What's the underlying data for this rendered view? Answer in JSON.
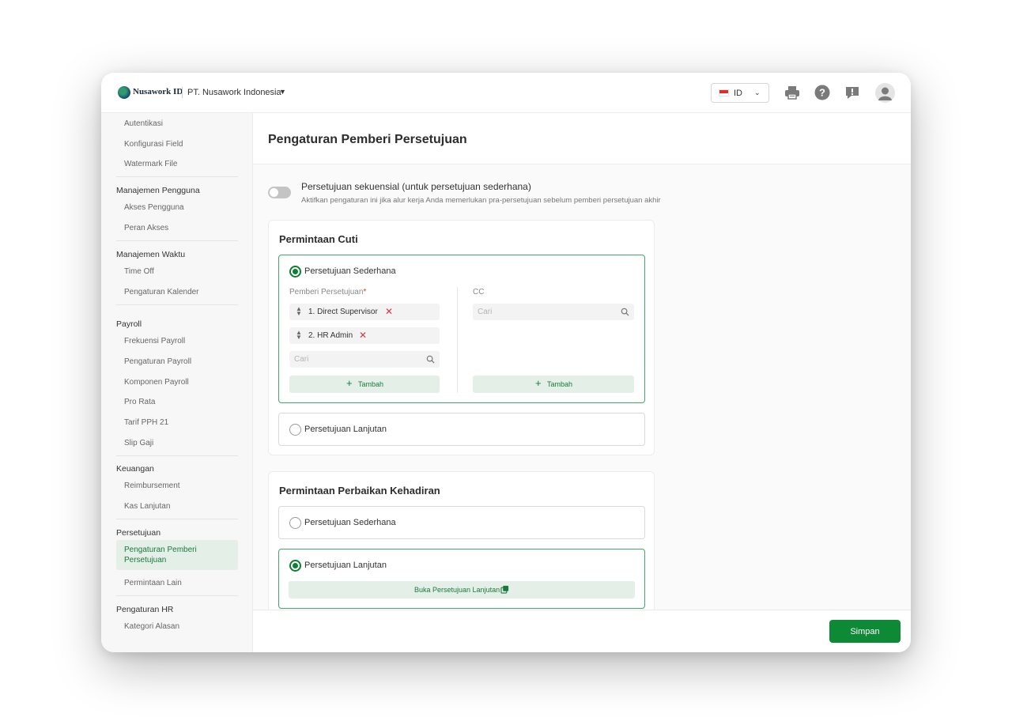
{
  "header": {
    "brand_name": "Nusawork ID",
    "company": "PT. Nusawork Indonesia",
    "language": "ID",
    "flag_colors": [
      "#e32b2b",
      "#ffffff"
    ]
  },
  "sidebar": {
    "items": [
      {
        "type": "item",
        "label": "Autentikasi"
      },
      {
        "type": "item",
        "label": "Konfigurasi Field"
      },
      {
        "type": "item",
        "label": "Watermark File"
      },
      {
        "type": "group",
        "label": "Manajemen Pengguna"
      },
      {
        "type": "item",
        "label": "Akses Pengguna"
      },
      {
        "type": "item",
        "label": "Peran Akses"
      },
      {
        "type": "group",
        "label": "Manajemen Waktu"
      },
      {
        "type": "item",
        "label": "Time Off"
      },
      {
        "type": "item",
        "label": "Pengaturan Kalender"
      },
      {
        "type": "group",
        "label": "Payroll"
      },
      {
        "type": "item",
        "label": "Frekuensi Payroll"
      },
      {
        "type": "item",
        "label": "Pengaturan Payroll"
      },
      {
        "type": "item",
        "label": "Komponen Payroll"
      },
      {
        "type": "item",
        "label": "Pro Rata"
      },
      {
        "type": "item",
        "label": "Tarif PPH 21"
      },
      {
        "type": "item",
        "label": "Slip Gaji"
      },
      {
        "type": "group",
        "label": "Keuangan"
      },
      {
        "type": "item",
        "label": "Reimbursement"
      },
      {
        "type": "item",
        "label": "Kas Lanjutan"
      },
      {
        "type": "group",
        "label": "Persetujuan"
      },
      {
        "type": "item",
        "label": "Pengaturan Pemberi Persetujuan",
        "active": true
      },
      {
        "type": "item",
        "label": "Permintaan Lain"
      },
      {
        "type": "group",
        "label": "Pengaturan HR"
      },
      {
        "type": "item",
        "label": "Kategori Alasan"
      }
    ]
  },
  "main": {
    "title": "Pengaturan Pemberi Persetujuan",
    "sequential": {
      "enabled": false,
      "title": "Persetujuan sekuensial (untuk persetujuan sederhana)",
      "description": "Aktifkan pengaturan ini jika alur kerja Anda memerlukan pra-persetujuan sebelum pemberi persetujuan akhir"
    },
    "cards": [
      {
        "title": "Permintaan Cuti",
        "simple": {
          "label": "Persetujuan Sederhana",
          "selected": true,
          "approvers_label": "Pemberi Persetujuan",
          "required_mark": "*",
          "approvers": [
            "1. Direct Supervisor",
            "2. HR Admin"
          ],
          "search_placeholder": "Cari",
          "add_label": "Tambah",
          "cc_label": "CC",
          "cc_search_placeholder": "Cari",
          "cc_add_label": "Tambah"
        },
        "advanced": {
          "label": "Persetujuan Lanjutan",
          "selected": false
        }
      },
      {
        "title": "Permintaan Perbaikan Kehadiran",
        "simple": {
          "label": "Persetujuan Sederhana",
          "selected": false
        },
        "advanced": {
          "label": "Persetujuan Lanjutan",
          "selected": true,
          "open_label": "Buka Persetujuan Lanjutan"
        }
      }
    ]
  },
  "footer": {
    "save_label": "Simpan"
  },
  "colors": {
    "accent": "#0e8a36",
    "accent_light": "#e3efe7",
    "danger": "#d9363e"
  }
}
